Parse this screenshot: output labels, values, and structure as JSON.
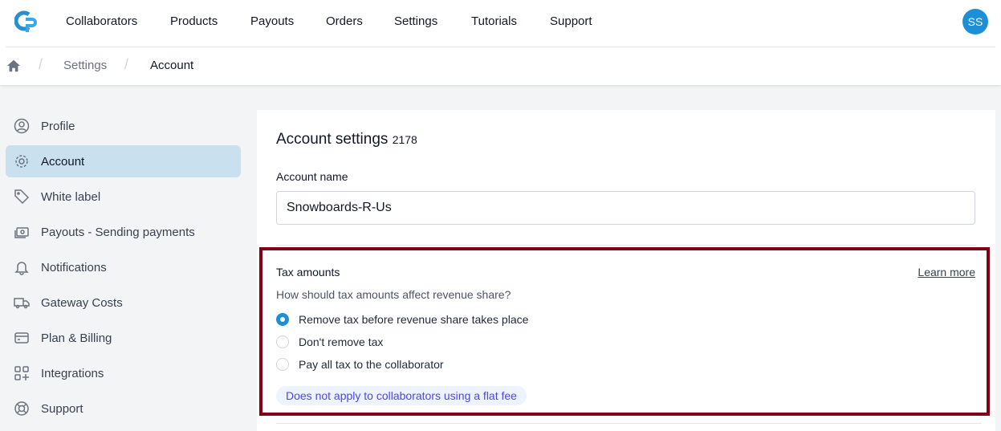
{
  "nav": {
    "items": [
      "Collaborators",
      "Products",
      "Payouts",
      "Orders",
      "Settings",
      "Tutorials",
      "Support"
    ],
    "avatar": "SS"
  },
  "breadcrumb": {
    "items": [
      "Settings",
      "Account"
    ]
  },
  "sidebar": {
    "items": [
      {
        "label": "Profile",
        "icon": "user-circle-icon"
      },
      {
        "label": "Account",
        "icon": "gear-icon",
        "active": true
      },
      {
        "label": "White label",
        "icon": "tag-icon"
      },
      {
        "label": "Payouts - Sending payments",
        "icon": "cash-icon"
      },
      {
        "label": "Notifications",
        "icon": "bell-icon"
      },
      {
        "label": "Gateway Costs",
        "icon": "truck-icon"
      },
      {
        "label": "Plan & Billing",
        "icon": "credit-card-icon"
      },
      {
        "label": "Integrations",
        "icon": "grid-plus-icon"
      },
      {
        "label": "Support",
        "icon": "lifebuoy-icon"
      }
    ]
  },
  "main": {
    "title": "Account settings",
    "account_id": "2178",
    "account_name_label": "Account name",
    "account_name_value": "Snowboards-R-Us",
    "tax": {
      "title": "Tax amounts",
      "learn_more": "Learn more",
      "question": "How should tax amounts affect revenue share?",
      "options": [
        "Remove tax before revenue share takes place",
        "Don't remove tax",
        "Pay all tax to the collaborator"
      ],
      "selected": 0,
      "note": "Does not apply to collaborators using a flat fee"
    }
  },
  "colors": {
    "accent": "#1d8fd6",
    "highlight": "#800018",
    "active_bg": "#c9e1ef"
  }
}
